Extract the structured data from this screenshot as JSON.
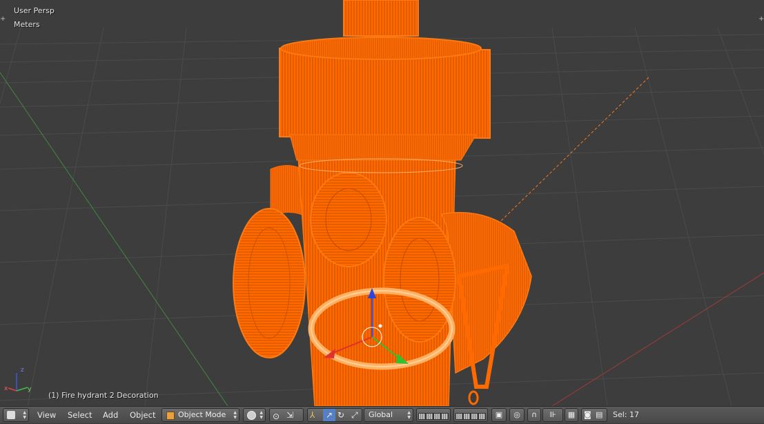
{
  "viewport": {
    "view_name": "User Persp",
    "units": "Meters",
    "object_info": "(1) Fire hydrant 2 Decoration",
    "colors": {
      "background": "#3d3d3d",
      "grid": "#4a4a4a",
      "wire": "#ff6a00",
      "x_axis": "#a33a3a",
      "y_axis": "#3f8a3f"
    },
    "axes_labels": {
      "x": "x",
      "y": "y",
      "z": "z"
    }
  },
  "header": {
    "editor_type_icon": "3d-view-icon",
    "menus": [
      "View",
      "Select",
      "Add",
      "Object"
    ],
    "mode": "Object Mode",
    "orientation": "Global",
    "selection": "Sel: 17"
  }
}
